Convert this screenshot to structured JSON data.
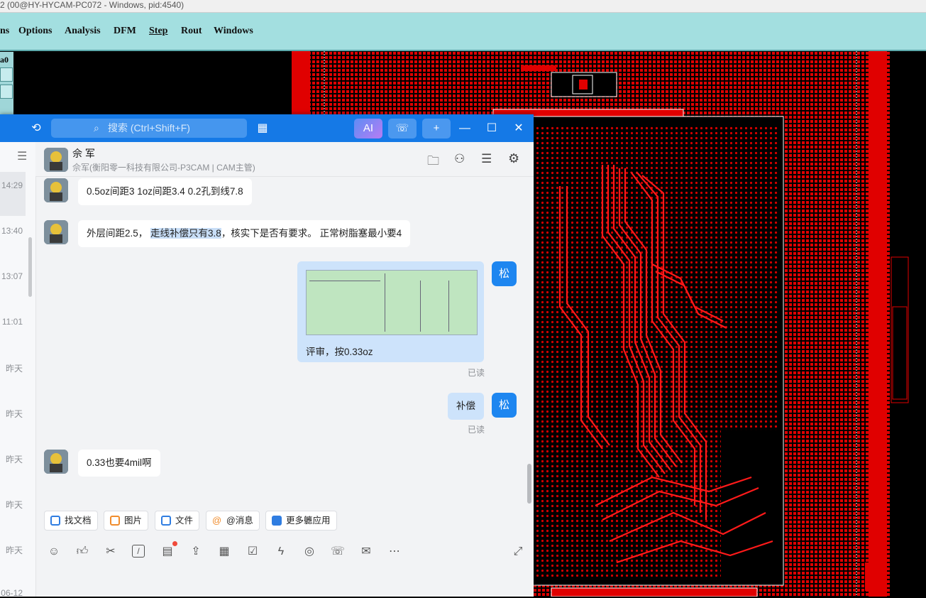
{
  "cam": {
    "title": "2 (00@HY-HYCAM-PC072 - Windows, pid:4540)",
    "menu": [
      "ns",
      "Options",
      "Analysis",
      "DFM",
      "Step",
      "Rout",
      "Windows"
    ],
    "strip_label": "a0"
  },
  "chat": {
    "search_placeholder": "搜索 (Ctrl+Shift+F)",
    "ai_button": "AI",
    "contact_name": "佘 军",
    "contact_subtitle": "佘军(衡阳零一科技有限公司-P3CAM | CAM主管)",
    "sidebar_times": [
      "14:29",
      "13:40",
      "13:07",
      "11:01",
      "昨天",
      "昨天",
      "昨天",
      "昨天",
      "昨天",
      "06-12"
    ],
    "messages": [
      {
        "from": "them",
        "text": "0.5oz间距3   1oz间距3.4    0.2孔到线7.8"
      },
      {
        "from": "them",
        "text_before": "外层间距2.5，  ",
        "text_highlight": "走线补偿只有3.8",
        "text_after": "，核实下是否有要求。 正常树脂塞最小要4"
      },
      {
        "from": "me",
        "avatar": "松",
        "caption": "评审，按0.33oz",
        "status": "已读"
      },
      {
        "from": "me",
        "avatar": "松",
        "text": "补偿",
        "status": "已读"
      },
      {
        "from": "them",
        "text": "0.33也要4mil啊"
      }
    ],
    "chips": [
      {
        "label": "找文档",
        "color": "#2f7de1"
      },
      {
        "label": "图片",
        "color": "#f08c2c"
      },
      {
        "label": "文件",
        "color": "#2f7de1"
      },
      {
        "label": "@消息",
        "color": "#f08c2c"
      },
      {
        "label": "更多軈应用",
        "color": "#2f7de1"
      }
    ]
  }
}
